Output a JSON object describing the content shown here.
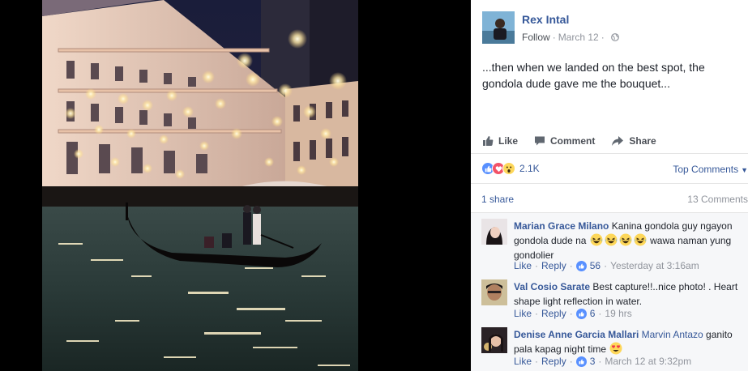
{
  "post": {
    "author": "Rex Intal",
    "follow_label": "Follow",
    "date": "March 12",
    "text": "...then when we landed on the best spot, the gondola dude gave me the bouquet..."
  },
  "actions": {
    "like": "Like",
    "comment": "Comment",
    "share": "Share"
  },
  "reactions": {
    "count": "2.1K",
    "top_comments_label": "Top Comments",
    "icons": [
      "like-icon",
      "love-icon",
      "wow-icon"
    ]
  },
  "stats": {
    "shares": "1 share",
    "comments": "13 Comments"
  },
  "comments": [
    {
      "name": "Marian Grace Milano",
      "text_before": "Kanina gondola guy ngayon gondola dude na",
      "emoji_count": 4,
      "text_after": "wawa naman yung gondolier",
      "like": "Like",
      "reply": "Reply",
      "likes": "56",
      "time": "Yesterday at 3:16am"
    },
    {
      "name": "Val Cosio Sarate",
      "text": "Best capture!!..nice photo! . Heart shape light reflection in water.",
      "like": "Like",
      "reply": "Reply",
      "likes": "6",
      "time": "19 hrs"
    },
    {
      "name": "Denise Anne Garcia Mallari",
      "tag": "Marvin Antazo",
      "text": "ganito pala kapag night time",
      "like": "Like",
      "reply": "Reply",
      "likes": "3",
      "time": "March 12 at 9:32pm"
    }
  ],
  "colors": {
    "link": "#365899",
    "secondary": "#90949c",
    "like_blue": "#5890ff",
    "love_red": "#f25268",
    "wow_yellow": "#fdd75a"
  }
}
